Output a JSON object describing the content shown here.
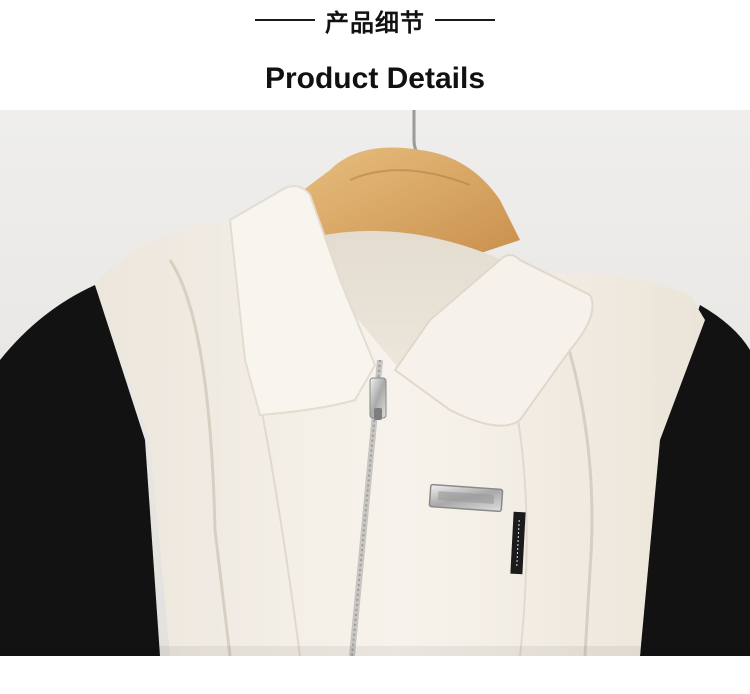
{
  "header": {
    "title_cn": "产品细节",
    "title_en": "Product Details"
  },
  "photo": {
    "subject": "garment-detail-photo",
    "colors": {
      "background": "#e9e7e5",
      "body": "#f5f1ea",
      "sleeve": "#111111",
      "hanger": "#d9a866",
      "zipper": "#b9b7b3"
    }
  }
}
